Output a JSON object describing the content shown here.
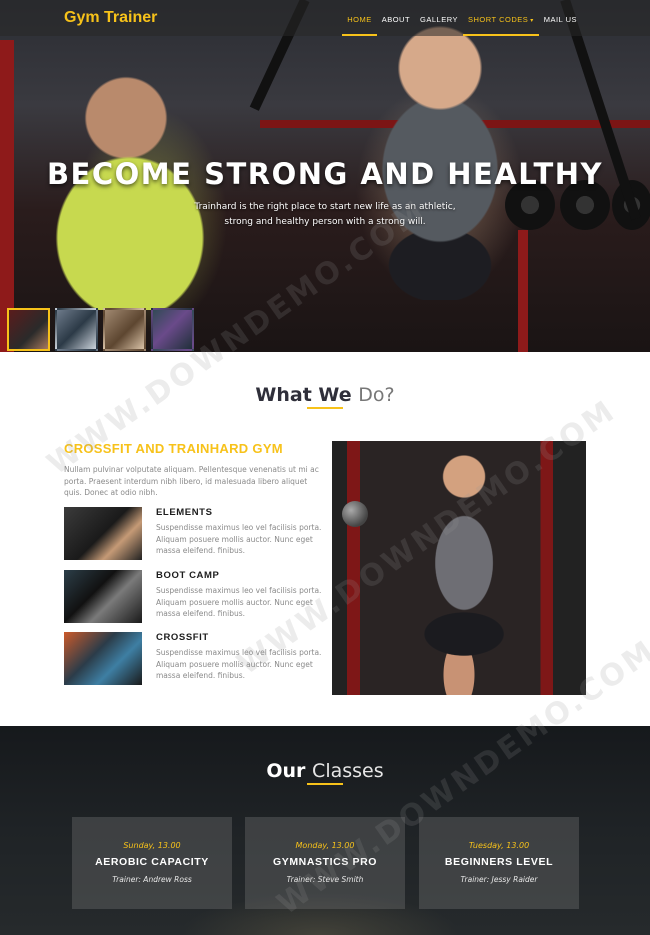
{
  "brand": "Gym Trainer",
  "nav": {
    "items": [
      {
        "label": "Home"
      },
      {
        "label": "About"
      },
      {
        "label": "Gallery"
      },
      {
        "label": "Short Codes",
        "caret": "▾"
      },
      {
        "label": "Mail Us"
      }
    ],
    "active_index": 0
  },
  "hero": {
    "title": "BECOME STRONG AND HEALTHY",
    "subtitle": "Trainhard is the right place to start new life as an athletic, strong and healthy person with a strong will.",
    "thumbnails_count": 4,
    "active_thumbnail": 0
  },
  "what_we_do": {
    "title_strong": "What We",
    "title_light": "Do?",
    "heading": "CROSSFIT AND TRAINHARD GYM",
    "intro": "Nullam pulvinar volputate aliquam. Pellentesque venenatis ut mi ac porta. Praesent interdum nibh libero, id malesuada libero aliquet quis. Donec at odio nibh.",
    "features": [
      {
        "title": "ELEMENTS",
        "text": "Suspendisse maximus leo vel facilisis porta. Aliquam posuere mollis auctor. Nunc eget massa eleifend. finibus."
      },
      {
        "title": "BOOT CAMP",
        "text": "Suspendisse maximus leo vel facilisis porta. Aliquam posuere mollis auctor. Nunc eget massa eleifend. finibus."
      },
      {
        "title": "CROSSFIT",
        "text": "Suspendisse maximus leo vel facilisis porta. Aliquam posuere mollis auctor. Nunc eget massa eleifend. finibus."
      }
    ]
  },
  "classes": {
    "title_strong": "Our",
    "title_light": "Classes",
    "cards": [
      {
        "time": "Sunday, 13.00",
        "name": "AEROBIC CAPACITY",
        "trainer": "Trainer: Andrew Ross"
      },
      {
        "time": "Monday, 13.00",
        "name": "GYMNASTICS PRO",
        "trainer": "Trainer: Steve Smith"
      },
      {
        "time": "Tuesday, 13.00",
        "name": "BEGINNERS LEVEL",
        "trainer": "Trainer: Jessy Raider"
      }
    ]
  },
  "watermark": "WWW.DOWNDEMO.COM",
  "colors": {
    "accent": "#f7c21a",
    "dark_text": "#1d1d1d",
    "body_text": "#8a8a8a",
    "classes_bg": "#1f2326"
  }
}
